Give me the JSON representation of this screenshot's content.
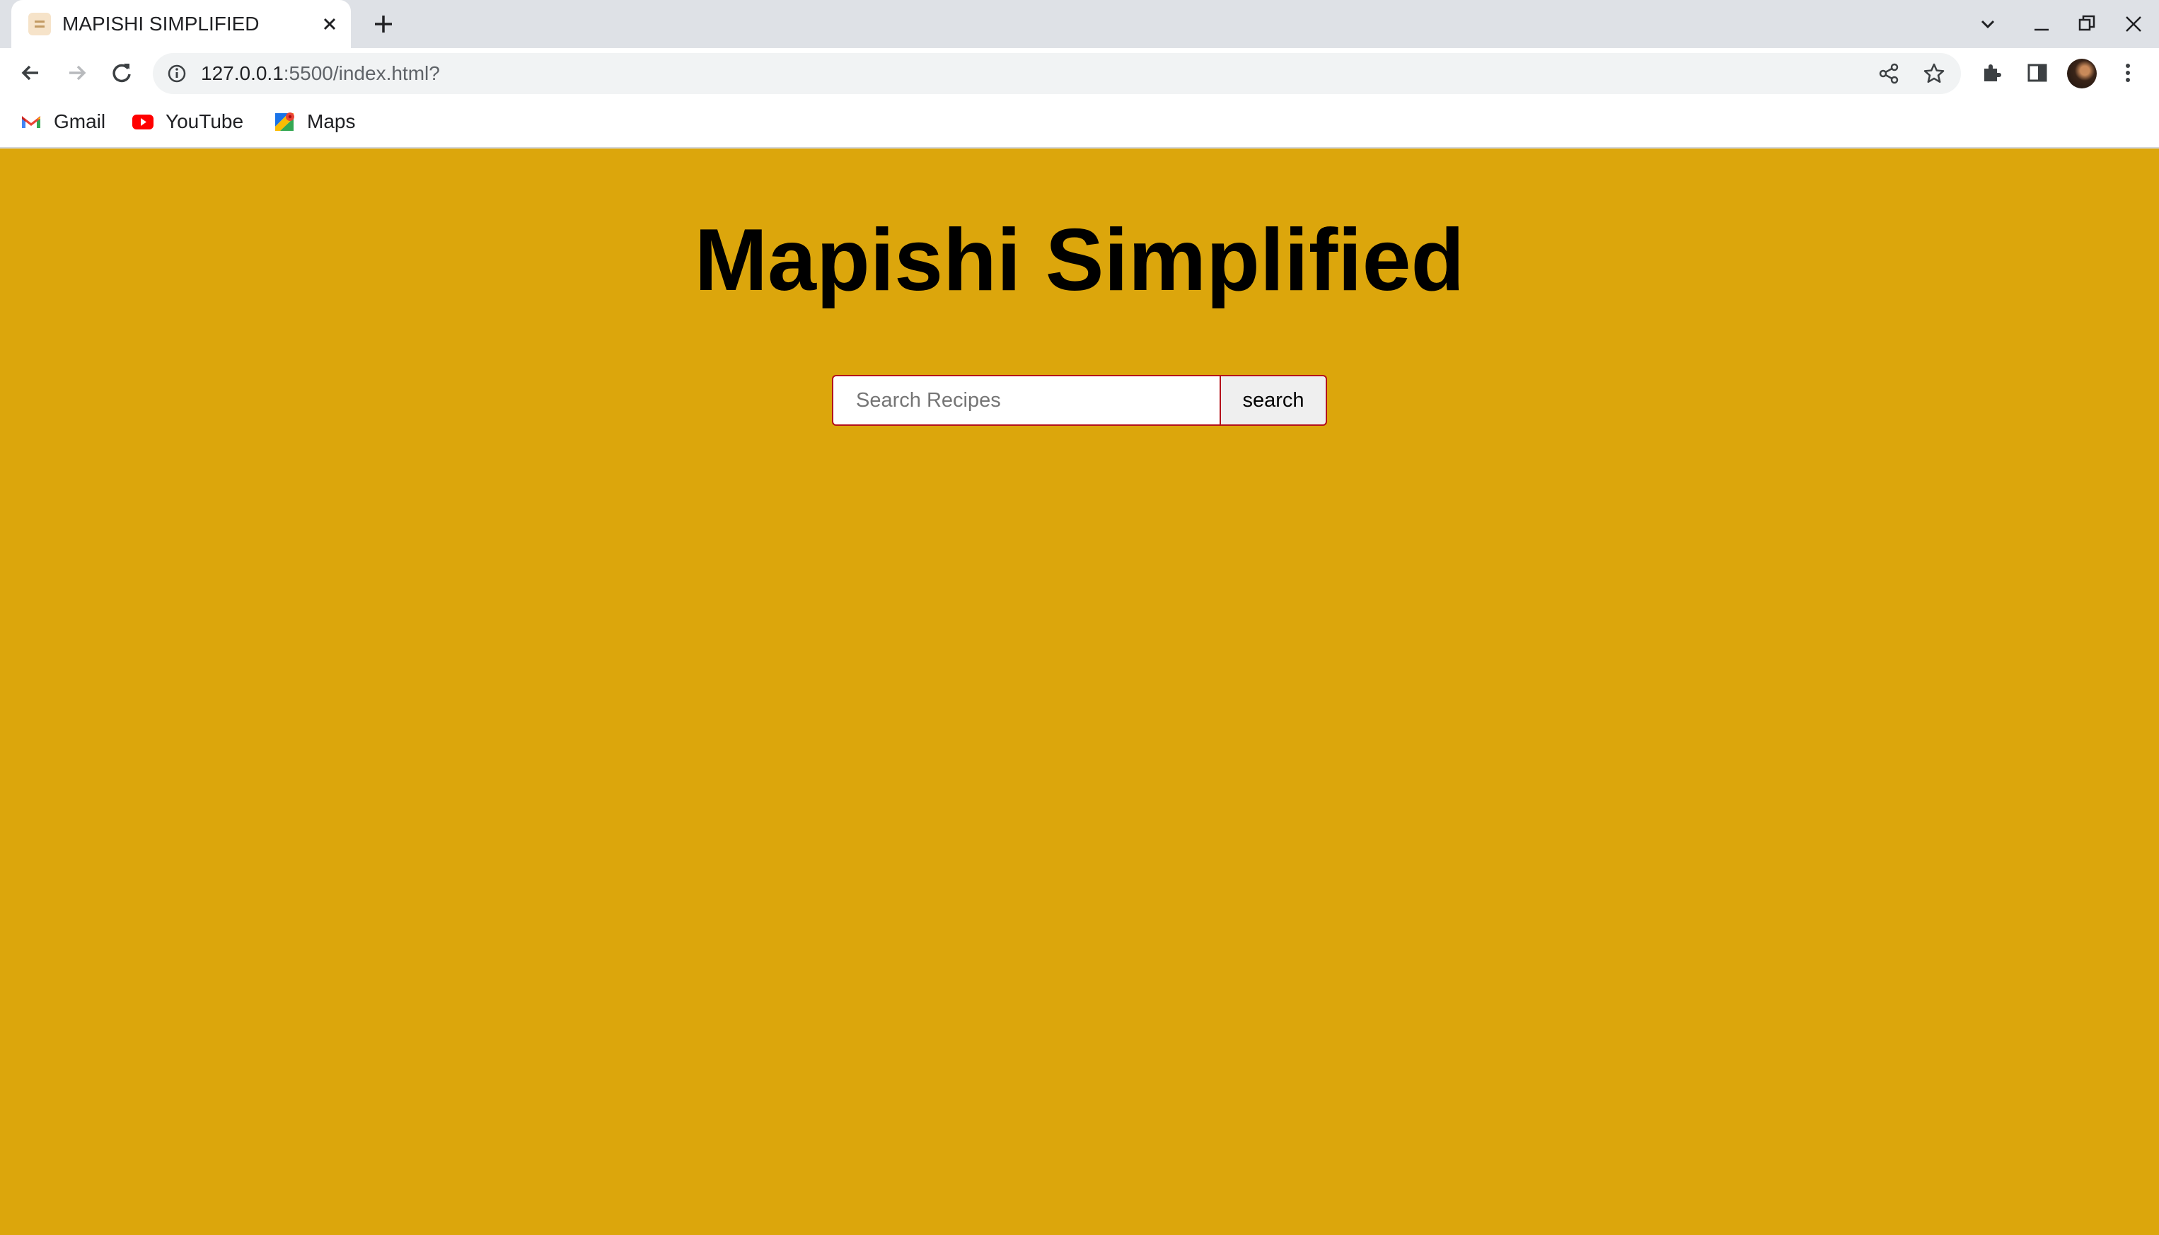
{
  "browser": {
    "tab": {
      "title": "MAPISHI SIMPLIFIED",
      "favicon": "document-icon"
    },
    "address_bar": {
      "host": "127.0.0.1",
      "path": ":5500/index.html?"
    },
    "bookmarks": [
      {
        "label": "Gmail",
        "icon": "gmail-icon"
      },
      {
        "label": "YouTube",
        "icon": "youtube-icon"
      },
      {
        "label": "Maps",
        "icon": "maps-icon"
      }
    ]
  },
  "page": {
    "title": "Mapishi Simplified",
    "search": {
      "placeholder": "Search Recipes",
      "value": "",
      "button_label": "search"
    }
  },
  "colors": {
    "page_background": "#dca60c",
    "search_border": "#b4111b"
  }
}
